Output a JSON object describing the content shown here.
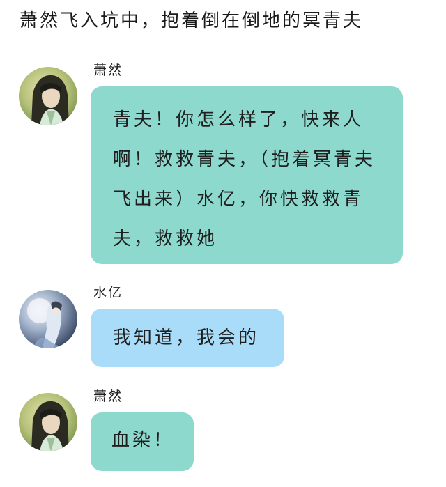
{
  "narration": "萧然飞入坑中，抱着倒在倒地的冥青夫",
  "messages": [
    {
      "sender": "萧然",
      "avatar": "xiaoran-avatar",
      "bubble_color": "#8dd9ce",
      "text": "青夫！你怎么样了，快来人啊！救救青夫，（抱着冥青夫飞出来）水亿，你快救救青夫，救救她"
    },
    {
      "sender": "水亿",
      "avatar": "shuiyi-avatar",
      "bubble_color": "#a8dcf8",
      "text": "我知道，我会的"
    },
    {
      "sender": "萧然",
      "avatar": "xiaoran-avatar",
      "bubble_color": "#8dd9ce",
      "text": "血染！"
    }
  ]
}
